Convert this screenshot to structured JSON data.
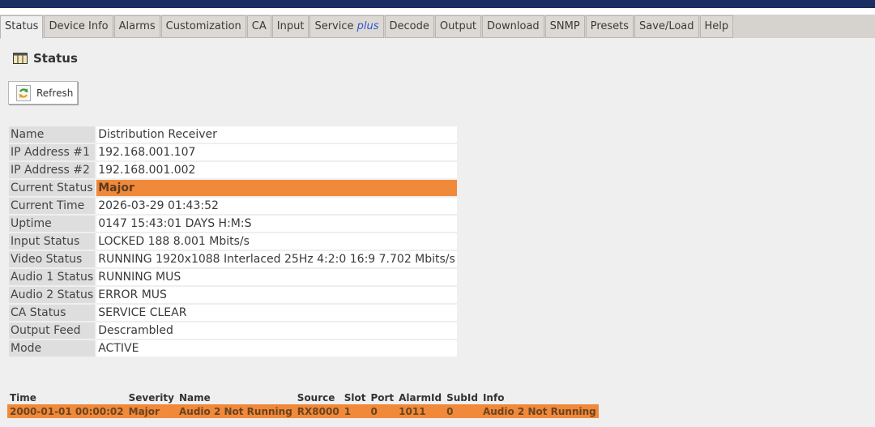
{
  "tabs": [
    {
      "label": "Status",
      "active": true
    },
    {
      "label": "Device Info"
    },
    {
      "label": "Alarms"
    },
    {
      "label": "Customization"
    },
    {
      "label": "CA"
    },
    {
      "label": "Input"
    },
    {
      "label": "Service",
      "suffix": "plus"
    },
    {
      "label": "Decode"
    },
    {
      "label": "Output"
    },
    {
      "label": "Download"
    },
    {
      "label": "SNMP"
    },
    {
      "label": "Presets"
    },
    {
      "label": "Save/Load"
    },
    {
      "label": "Help"
    }
  ],
  "page": {
    "title": "Status",
    "title_icon": "panel-icon",
    "refresh_label": "Refresh",
    "refresh_icon": "refresh-icon"
  },
  "status": [
    {
      "key": "Name",
      "value": "Distribution Receiver"
    },
    {
      "key": "IP Address #1",
      "value": "192.168.001.107"
    },
    {
      "key": "IP Address #2",
      "value": "192.168.001.002"
    },
    {
      "key": "Current Status",
      "value": "Major",
      "highlight": true
    },
    {
      "key": "Current Time",
      "value": "2026-03-29 01:43:52"
    },
    {
      "key": "Uptime",
      "value": "0147 15:43:01 DAYS H:M:S"
    },
    {
      "key": "Input Status",
      "value": "LOCKED 188 8.001 Mbits/s"
    },
    {
      "key": "Video Status",
      "value": "RUNNING 1920x1088 Interlaced 25Hz 4:2:0 16:9 7.702 Mbits/s"
    },
    {
      "key": "Audio 1 Status",
      "value": "RUNNING MUS"
    },
    {
      "key": "Audio 2 Status",
      "value": "ERROR MUS"
    },
    {
      "key": "CA Status",
      "value": "SERVICE CLEAR"
    },
    {
      "key": "Output Feed",
      "value": "Descrambled"
    },
    {
      "key": "Mode",
      "value": "ACTIVE"
    }
  ],
  "alarms": {
    "headers": [
      "Time",
      "Severity",
      "Name",
      "Source",
      "Slot",
      "Port",
      "AlarmId",
      "SubId",
      "Info"
    ],
    "rows": [
      [
        "2000-01-01 00:00:02",
        "Major",
        "Audio 2 Not Running",
        "RX8000",
        "1",
        "0",
        "1011",
        "0",
        "Audio 2 Not Running"
      ]
    ]
  },
  "colors": {
    "major": "#f0893a",
    "header_bar": "#1b2f63"
  }
}
